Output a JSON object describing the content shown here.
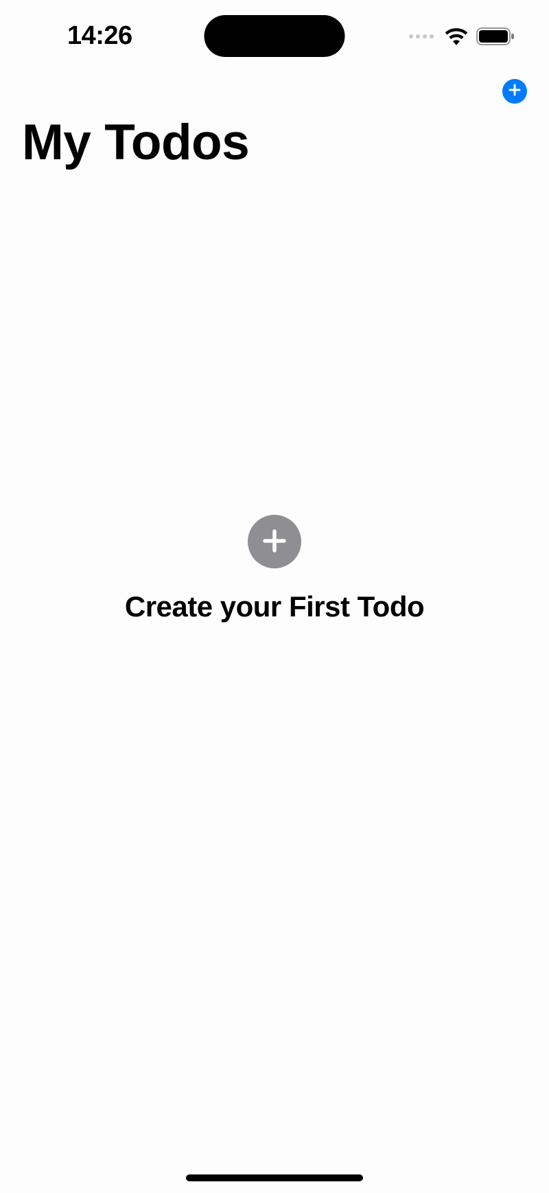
{
  "statusBar": {
    "time": "14:26"
  },
  "nav": {
    "addButtonAria": "Add Todo"
  },
  "header": {
    "title": "My Todos"
  },
  "emptyState": {
    "addButtonAria": "Create Todo",
    "message": "Create your First Todo"
  }
}
